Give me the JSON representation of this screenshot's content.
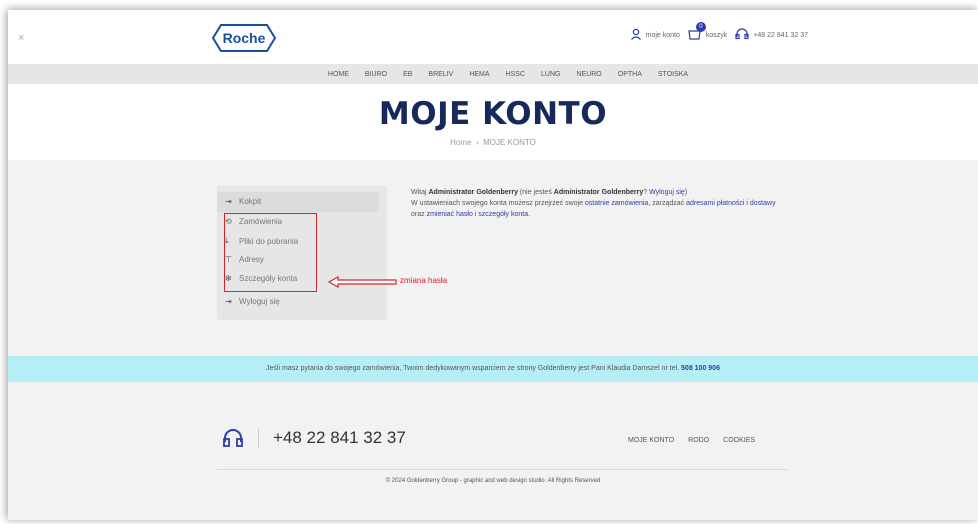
{
  "header": {
    "close_symbol": "×",
    "logo_text": "Roche",
    "account_label": "moje konto",
    "cart_label": "koszyk",
    "cart_count": "0",
    "phone": "+48 22 841 32 37"
  },
  "nav": [
    "HOME",
    "BIURO",
    "EB",
    "BRELIV",
    "HEMA",
    "HSSC",
    "LUNG",
    "NEURO",
    "OPTHA",
    "STOISKA"
  ],
  "hero": {
    "title": "MOJE KONTO",
    "breadcrumb_home": "Home",
    "breadcrumb_sep": "›",
    "breadcrumb_current": "MOJE KONTO"
  },
  "sidebar": {
    "items": [
      {
        "icon": "dashboard-icon",
        "label": "Kokpit"
      },
      {
        "icon": "orders-icon",
        "label": "Zamówienia"
      },
      {
        "icon": "download-icon",
        "label": "Pliki do pobrania"
      },
      {
        "icon": "address-icon",
        "label": "Adresy"
      },
      {
        "icon": "settings-icon",
        "label": "Szczegóły konta"
      },
      {
        "icon": "logout-icon",
        "label": "Wyloguj się"
      }
    ]
  },
  "annotation": {
    "label": "zmiana hasła",
    "color": "#d3252a"
  },
  "welcome": {
    "greet_pre": "Witaj ",
    "user_name": "Administrator Goldenberry",
    "not_you_pre": " (nie jesteś ",
    "not_you_name": "Administrator Goldenberry",
    "not_you_q": "? ",
    "logout_link": "Wyloguj się",
    "close_paren": ")",
    "line2_pre": "W ustawieniach swojego konta możesz przejrzeć swoje ",
    "recent_orders_link": "ostatnie zamówienia",
    "line2_mid": ", zarządzać ",
    "addresses_link": "adresami płatności i dostawy",
    "line2_mid2": " oraz ",
    "change_pw_link": "zmieniać hasło i szczegóły konta",
    "line2_end": "."
  },
  "support": {
    "text": "Jeśli masz pytania do swojego zamówienia, Twoim dedykowanym wsparciem ze strony Goldenberry jest Pani Klaudia Damszel nr tel. ",
    "phone": "508 100 906"
  },
  "footer": {
    "phone": "+48 22 841 32 37",
    "links": [
      "MOJE KONTO",
      "RODO",
      "COOKIES"
    ],
    "copyright": "© 2024 Goldenberry Group - graphic and web design studio. All Rights Reserved"
  },
  "colors": {
    "accent": "#2e3da8",
    "title": "#16295a",
    "support_bg": "#b5eff5",
    "annotation": "#d3252a"
  }
}
